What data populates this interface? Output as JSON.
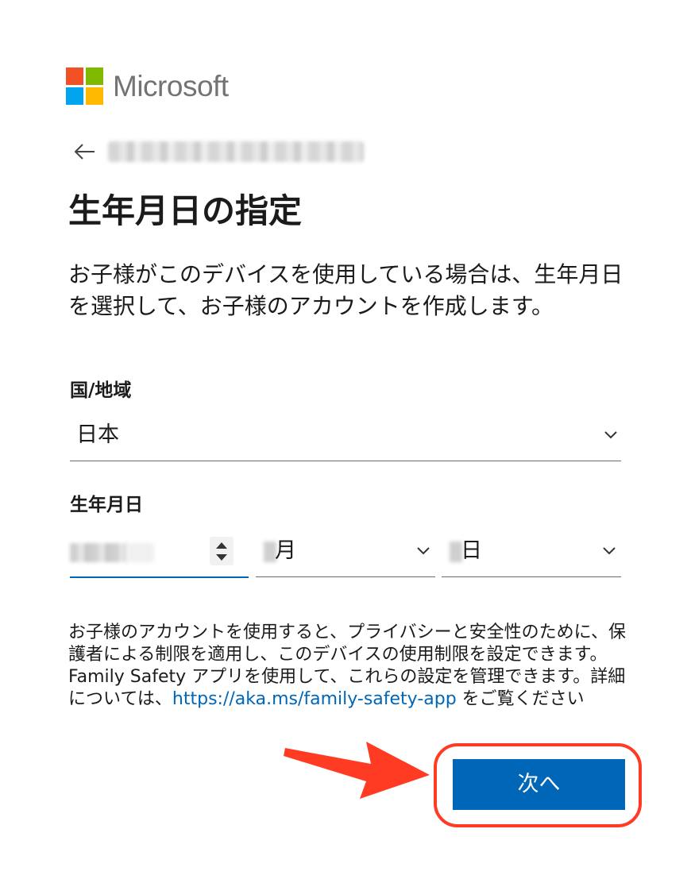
{
  "brand": {
    "name": "Microsoft",
    "colors": {
      "red": "#f25022",
      "green": "#7fba00",
      "blue": "#00a4ef",
      "yellow": "#ffb900"
    }
  },
  "header": {
    "back_icon": "arrow-left-icon",
    "email": ""
  },
  "page": {
    "title": "生年月日の指定",
    "description": "お子様がこのデバイスを使用している場合は、生年月日を選択して、お子様のアカウントを作成します。"
  },
  "form": {
    "country_label": "国/地域",
    "country_value": "日本",
    "birthdate_label": "生年月日",
    "month_unit": "月",
    "day_unit": "日"
  },
  "notice": {
    "text_before_link": "お子様のアカウントを使用すると、プライバシーと安全性のために、保護者による制限を適用し、このデバイスの使用制限を設定できます。Family Safety アプリを使用して、これらの設定を管理できます。詳細については、",
    "link": "https://aka.ms/family-safety-app",
    "text_after_link": " をご覧ください"
  },
  "actions": {
    "next_label": "次へ",
    "accent_color": "#0067b8"
  },
  "annotation": {
    "color": "#ff3b24"
  }
}
